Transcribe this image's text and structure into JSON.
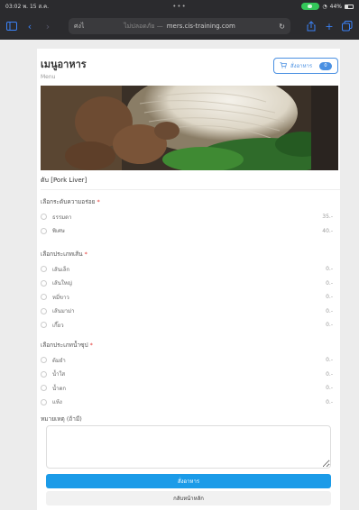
{
  "status_bar": {
    "time": "03:02 พ. 15 ส.ค.",
    "dots": "•••",
    "battery": "44%"
  },
  "browser": {
    "reader_label": "ศงไ",
    "insecure_label": "ไม่ปลอดภัย —",
    "url": "mers.cis-training.com",
    "icons": [
      "sidebar-icon",
      "back-icon",
      "forward-icon",
      "reload-icon",
      "share-icon",
      "new-tab-icon",
      "tabs-icon"
    ]
  },
  "page": {
    "title": "เมนูอาหาร",
    "subtitle": "Menu",
    "cart_label": "สั่งอาหาร",
    "cart_count": "0",
    "item_name": "ตับ [Pork Liver]",
    "groups": [
      {
        "title": "เลือกระดับความอร่อย",
        "required_mark": "*",
        "options": [
          {
            "label": "ธรรมดา",
            "price": "35.-"
          },
          {
            "label": "พิเศษ",
            "price": "40.-"
          }
        ]
      },
      {
        "title": "เลือกประเภทเส้น",
        "required_mark": "*",
        "options": [
          {
            "label": "เส้นเล็ก",
            "price": "0.-"
          },
          {
            "label": "เส้นใหญ่",
            "price": "0.-"
          },
          {
            "label": "หมี่ขาว",
            "price": "0.-"
          },
          {
            "label": "เส้นมาม่า",
            "price": "0.-"
          },
          {
            "label": "เกี๊ยว",
            "price": "0.-"
          }
        ]
      },
      {
        "title": "เลือกประเภทน้ำซุป",
        "required_mark": "*",
        "options": [
          {
            "label": "ต้มยำ",
            "price": "0.-"
          },
          {
            "label": "น้ำใส",
            "price": "0.-"
          },
          {
            "label": "น้ำตก",
            "price": "0.-"
          },
          {
            "label": "แห้ง",
            "price": "0.-"
          }
        ]
      }
    ],
    "note_label": "หมายเหตุ (ถ้ามี)",
    "note_value": "",
    "order_button": "สั่งอาหาร",
    "back_button": "กลับหน้าหลัก"
  }
}
